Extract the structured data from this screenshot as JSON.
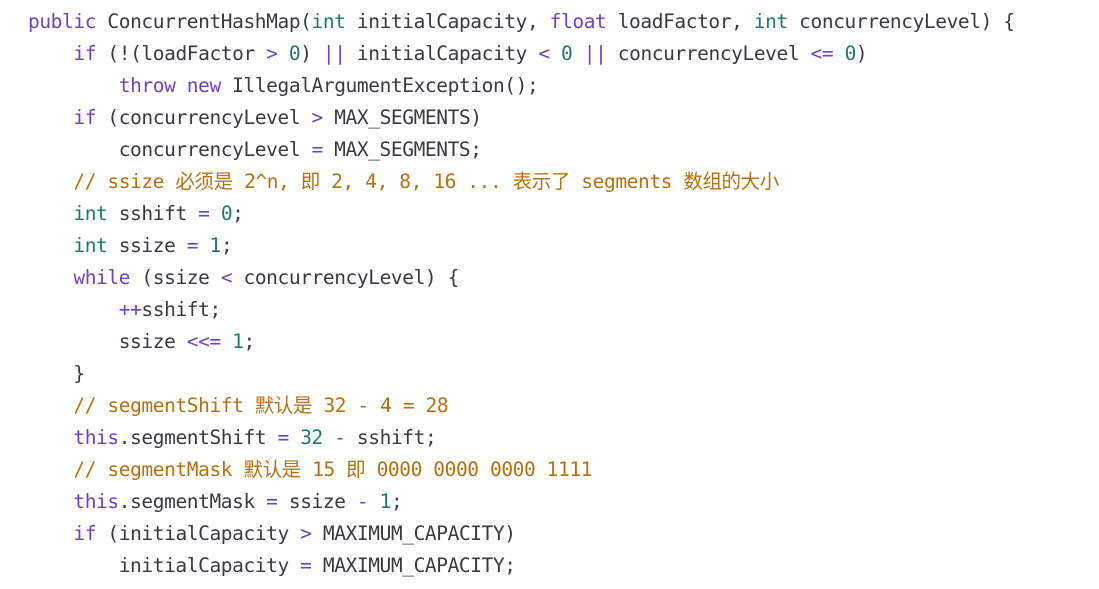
{
  "code_lines": [
    [
      {
        "cls": "kw",
        "t": "public"
      },
      {
        "cls": "txt",
        "t": " ConcurrentHashMap("
      },
      {
        "cls": "typ",
        "t": "int"
      },
      {
        "cls": "txt",
        "t": " initialCapacity, "
      },
      {
        "cls": "kw",
        "t": "float"
      },
      {
        "cls": "txt",
        "t": " loadFactor, "
      },
      {
        "cls": "typ",
        "t": "int"
      },
      {
        "cls": "txt",
        "t": " concurrencyLevel) {"
      }
    ],
    [
      {
        "cls": "txt",
        "t": "    "
      },
      {
        "cls": "kw",
        "t": "if"
      },
      {
        "cls": "txt",
        "t": " (!(loadFactor "
      },
      {
        "cls": "op",
        "t": ">"
      },
      {
        "cls": "txt",
        "t": " "
      },
      {
        "cls": "num",
        "t": "0"
      },
      {
        "cls": "txt",
        "t": ") "
      },
      {
        "cls": "op",
        "t": "||"
      },
      {
        "cls": "txt",
        "t": " initialCapacity "
      },
      {
        "cls": "op",
        "t": "<"
      },
      {
        "cls": "txt",
        "t": " "
      },
      {
        "cls": "num",
        "t": "0"
      },
      {
        "cls": "txt",
        "t": " "
      },
      {
        "cls": "op",
        "t": "||"
      },
      {
        "cls": "txt",
        "t": " concurrencyLevel "
      },
      {
        "cls": "op",
        "t": "<="
      },
      {
        "cls": "txt",
        "t": " "
      },
      {
        "cls": "num",
        "t": "0"
      },
      {
        "cls": "txt",
        "t": ")"
      }
    ],
    [
      {
        "cls": "txt",
        "t": "        "
      },
      {
        "cls": "kw",
        "t": "throw"
      },
      {
        "cls": "txt",
        "t": " "
      },
      {
        "cls": "kw",
        "t": "new"
      },
      {
        "cls": "txt",
        "t": " IllegalArgumentException();"
      }
    ],
    [
      {
        "cls": "txt",
        "t": "    "
      },
      {
        "cls": "kw",
        "t": "if"
      },
      {
        "cls": "txt",
        "t": " (concurrencyLevel "
      },
      {
        "cls": "op",
        "t": ">"
      },
      {
        "cls": "txt",
        "t": " MAX_SEGMENTS)"
      }
    ],
    [
      {
        "cls": "txt",
        "t": "        concurrencyLevel "
      },
      {
        "cls": "op",
        "t": "="
      },
      {
        "cls": "txt",
        "t": " MAX_SEGMENTS;"
      }
    ],
    [
      {
        "cls": "txt",
        "t": "    "
      },
      {
        "cls": "cmt",
        "t": "// ssize 必须是 2^n, 即 2, 4, 8, 16 ... 表示了 segments 数组的大小"
      }
    ],
    [
      {
        "cls": "txt",
        "t": "    "
      },
      {
        "cls": "typ",
        "t": "int"
      },
      {
        "cls": "txt",
        "t": " sshift "
      },
      {
        "cls": "op",
        "t": "="
      },
      {
        "cls": "txt",
        "t": " "
      },
      {
        "cls": "num",
        "t": "0"
      },
      {
        "cls": "txt",
        "t": ";"
      }
    ],
    [
      {
        "cls": "txt",
        "t": "    "
      },
      {
        "cls": "typ",
        "t": "int"
      },
      {
        "cls": "txt",
        "t": " ssize "
      },
      {
        "cls": "op",
        "t": "="
      },
      {
        "cls": "txt",
        "t": " "
      },
      {
        "cls": "num",
        "t": "1"
      },
      {
        "cls": "txt",
        "t": ";"
      }
    ],
    [
      {
        "cls": "txt",
        "t": "    "
      },
      {
        "cls": "kw",
        "t": "while"
      },
      {
        "cls": "txt",
        "t": " (ssize "
      },
      {
        "cls": "op",
        "t": "<"
      },
      {
        "cls": "txt",
        "t": " concurrencyLevel) {"
      }
    ],
    [
      {
        "cls": "txt",
        "t": "        "
      },
      {
        "cls": "op",
        "t": "++"
      },
      {
        "cls": "txt",
        "t": "sshift;"
      }
    ],
    [
      {
        "cls": "txt",
        "t": "        ssize "
      },
      {
        "cls": "op",
        "t": "<<="
      },
      {
        "cls": "txt",
        "t": " "
      },
      {
        "cls": "num",
        "t": "1"
      },
      {
        "cls": "txt",
        "t": ";"
      }
    ],
    [
      {
        "cls": "txt",
        "t": "    }"
      }
    ],
    [
      {
        "cls": "txt",
        "t": "    "
      },
      {
        "cls": "cmt",
        "t": "// segmentShift 默认是 32 - 4 = 28"
      }
    ],
    [
      {
        "cls": "txt",
        "t": "    "
      },
      {
        "cls": "kw",
        "t": "this"
      },
      {
        "cls": "txt",
        "t": ".segmentShift "
      },
      {
        "cls": "op",
        "t": "="
      },
      {
        "cls": "txt",
        "t": " "
      },
      {
        "cls": "num",
        "t": "32"
      },
      {
        "cls": "txt",
        "t": " "
      },
      {
        "cls": "op",
        "t": "-"
      },
      {
        "cls": "txt",
        "t": " sshift;"
      }
    ],
    [
      {
        "cls": "txt",
        "t": "    "
      },
      {
        "cls": "cmt",
        "t": "// segmentMask 默认是 15 即 0000 0000 0000 1111"
      }
    ],
    [
      {
        "cls": "txt",
        "t": "    "
      },
      {
        "cls": "kw",
        "t": "this"
      },
      {
        "cls": "txt",
        "t": ".segmentMask "
      },
      {
        "cls": "op",
        "t": "="
      },
      {
        "cls": "txt",
        "t": " ssize "
      },
      {
        "cls": "op",
        "t": "-"
      },
      {
        "cls": "txt",
        "t": " "
      },
      {
        "cls": "num",
        "t": "1"
      },
      {
        "cls": "txt",
        "t": ";"
      }
    ],
    [
      {
        "cls": "txt",
        "t": "    "
      },
      {
        "cls": "kw",
        "t": "if"
      },
      {
        "cls": "txt",
        "t": " (initialCapacity "
      },
      {
        "cls": "op",
        "t": ">"
      },
      {
        "cls": "txt",
        "t": " MAXIMUM_CAPACITY)"
      }
    ],
    [
      {
        "cls": "txt",
        "t": "        initialCapacity "
      },
      {
        "cls": "op",
        "t": "="
      },
      {
        "cls": "txt",
        "t": " MAXIMUM_CAPACITY;"
      }
    ]
  ]
}
